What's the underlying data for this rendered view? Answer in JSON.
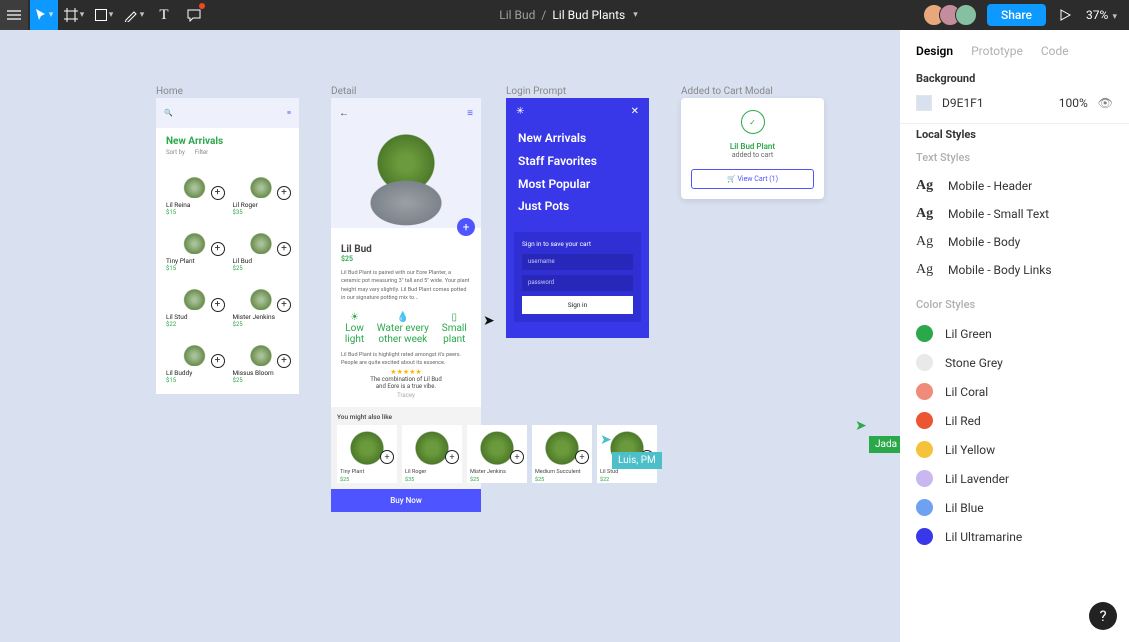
{
  "toolbar": {
    "project": "Lil Bud",
    "file": "Lil Bud Plants",
    "share": "Share",
    "zoom": "37%"
  },
  "frames": {
    "home": {
      "label": "Home"
    },
    "detail": {
      "label": "Detail"
    },
    "login": {
      "label": "Login Prompt"
    },
    "cart": {
      "label": "Added to Cart Modal"
    }
  },
  "home": {
    "heading": "New Arrivals",
    "filters": {
      "sort": "Sort by",
      "filter": "Filter"
    },
    "products": [
      {
        "name": "Lil Reina",
        "price": "$15"
      },
      {
        "name": "Lil Roger",
        "price": "$35"
      },
      {
        "name": "Tiny Plant",
        "price": "$15"
      },
      {
        "name": "Lil Bud",
        "price": "$25"
      },
      {
        "name": "Lil Stud",
        "price": "$22"
      },
      {
        "name": "Mister Jenkins",
        "price": "$25"
      },
      {
        "name": "Lil Buddy",
        "price": "$15"
      },
      {
        "name": "Missus Bloom",
        "price": "$25"
      }
    ]
  },
  "detail": {
    "title": "Lil Bud",
    "price": "$25",
    "desc": "Lil Bud Plant is paired with our Eore Planter, a ceramic pot measuring 3\" tall and 5\" wide. Your plant height may vary slightly. Lil Bud Plant comes potted in our signature potting mix to...",
    "traits": {
      "light": "Low light",
      "water": "Water every other week",
      "size": "Small plant"
    },
    "highlight": "Lil Bud Plant is highlight rated amongst it's peers. People are quite excited about its essence.",
    "review": {
      "stars": "★★★★★",
      "line1": "The combination of Lil Bud",
      "line2": "and Eore is a true vibe.",
      "author": "Tracey"
    },
    "suggest_heading": "You might also like",
    "suggestions": [
      {
        "name": "Tiny Plant",
        "price": "$25"
      },
      {
        "name": "Lil Roger",
        "price": "$35"
      },
      {
        "name": "Mister Jenkins",
        "price": "$25"
      },
      {
        "name": "Medium Succulent",
        "price": "$25"
      },
      {
        "name": "Lil Stud",
        "price": "$22"
      }
    ],
    "buy": "Buy Now"
  },
  "login": {
    "nav": [
      "New Arrivals",
      "Staff Favorites",
      "Most Popular",
      "Just Pots"
    ],
    "card_title": "Sign in to save your cart",
    "username_ph": "username",
    "password_ph": "password",
    "submit": "Sign in"
  },
  "cart": {
    "product": "Lil Bud Plant",
    "status": "added to cart",
    "cta": "View Cart (1)"
  },
  "cursors": {
    "luis": "Luis, PM",
    "jada": "Jada"
  },
  "panel": {
    "tabs": {
      "design": "Design",
      "prototype": "Prototype",
      "code": "Code"
    },
    "background": {
      "label": "Background",
      "hex": "D9E1F1",
      "opacity": "100%"
    },
    "local_styles": "Local Styles",
    "text_styles_label": "Text Styles",
    "text_styles": [
      "Mobile - Header",
      "Mobile - Small Text",
      "Mobile - Body",
      "Mobile - Body Links"
    ],
    "color_styles_label": "Color Styles",
    "colors": [
      {
        "name": "Lil Green",
        "hex": "#2ba84a"
      },
      {
        "name": "Stone Grey",
        "hex": "#e9e9e9"
      },
      {
        "name": "Lil Coral",
        "hex": "#f08a7a"
      },
      {
        "name": "Lil Red",
        "hex": "#eb5532"
      },
      {
        "name": "Lil Yellow",
        "hex": "#f5c33b"
      },
      {
        "name": "Lil Lavender",
        "hex": "#c9b8f0"
      },
      {
        "name": "Lil Blue",
        "hex": "#6fa1f2"
      },
      {
        "name": "Lil Ultramarine",
        "hex": "#3838e8"
      }
    ]
  }
}
